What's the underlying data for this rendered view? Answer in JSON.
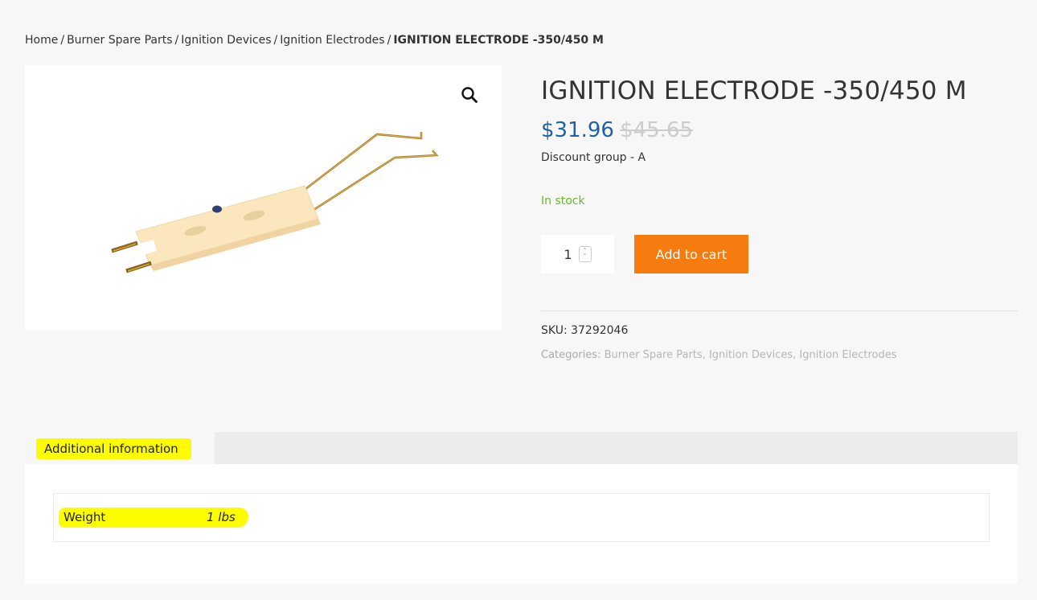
{
  "breadcrumb": {
    "items": [
      {
        "label": "Home"
      },
      {
        "label": "Burner Spare Parts"
      },
      {
        "label": "Ignition Devices"
      },
      {
        "label": "Ignition Electrodes"
      }
    ],
    "separator": "/",
    "current": "IGNITION ELECTRODE -350/450 M"
  },
  "product": {
    "title": "IGNITION ELECTRODE -350/450 M",
    "sale_price": "$31.96",
    "regular_price": "$45.65",
    "discount_group": "Discount group - A",
    "stock_status": "In stock",
    "quantity": "1",
    "add_to_cart_label": "Add to cart",
    "sku_label": "SKU:",
    "sku": "37292046",
    "categories_label": "Categories:",
    "categories": [
      "Burner Spare Parts",
      "Ignition Devices",
      "Ignition Electrodes"
    ],
    "zoom_icon": "magnifier-icon"
  },
  "tabs": [
    {
      "label": "Additional information",
      "active": true
    }
  ],
  "attributes": [
    {
      "name": "Weight",
      "value": "1 lbs"
    }
  ],
  "colors": {
    "accent_button": "#f67c0f",
    "sale_price": "#1d63a3",
    "in_stock": "#66bb23",
    "highlight": "#fdfd00"
  }
}
